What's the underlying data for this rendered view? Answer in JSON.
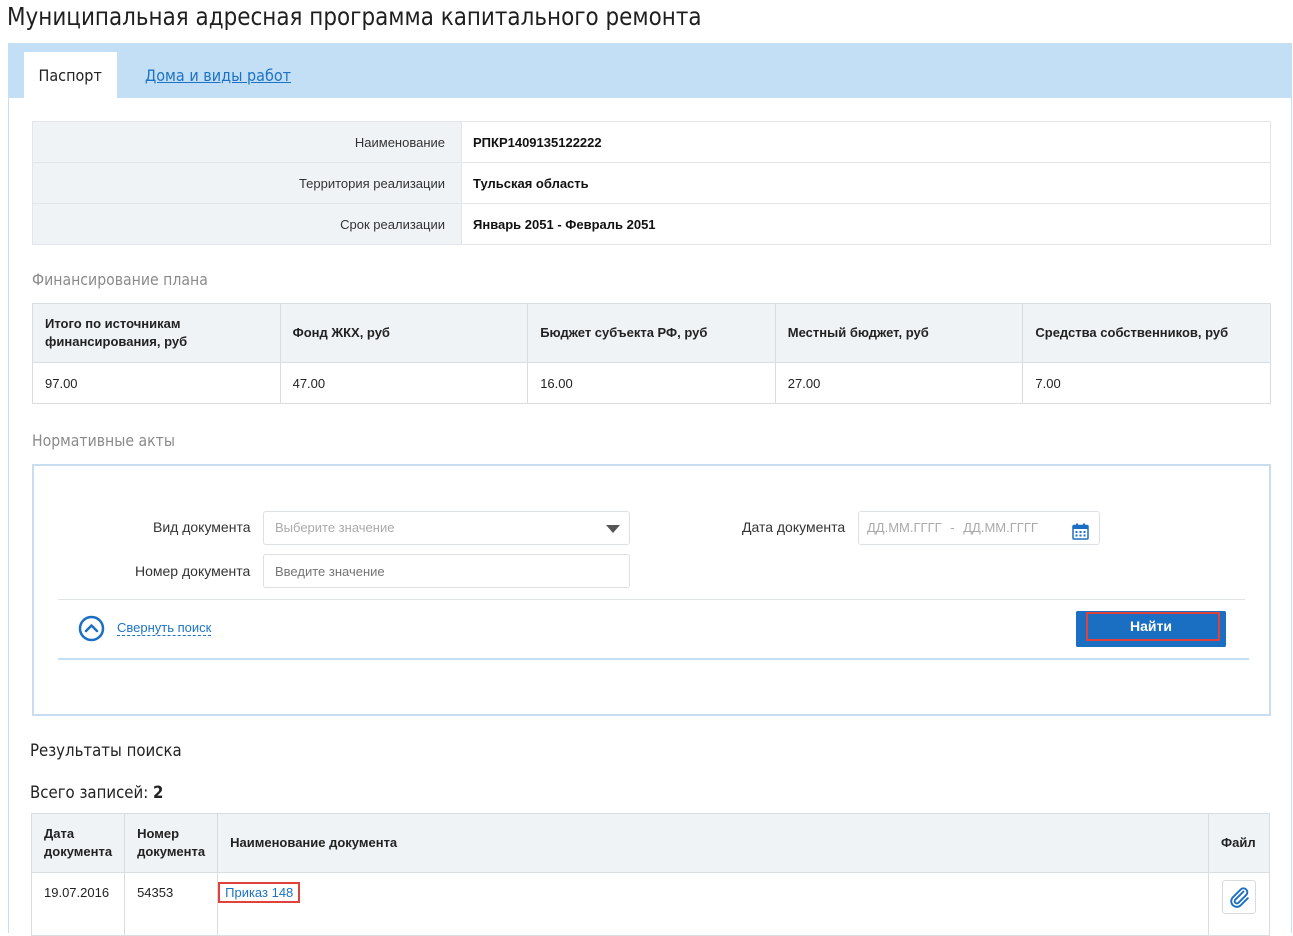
{
  "page": {
    "title": "Муниципальная адресная программа капитального ремонта"
  },
  "tabs": [
    {
      "label": "Паспорт",
      "active": true
    },
    {
      "label": "Дома и виды работ",
      "active": false
    }
  ],
  "info": {
    "rows": [
      {
        "label": "Наименование",
        "value": "РПКР1409135122222"
      },
      {
        "label": "Территория реализации",
        "value": "Тульская область"
      },
      {
        "label": "Срок реализации",
        "value": "Январь 2051  - Февраль 2051"
      }
    ]
  },
  "financing": {
    "title": "Финансирование плана",
    "headers": [
      "Итого по источникам финансирования, руб",
      "Фонд ЖКХ, руб",
      "Бюджет субъекта РФ, руб",
      "Местный бюджет, руб",
      "Средства собственников, руб"
    ],
    "values": [
      "97.00",
      "47.00",
      "16.00",
      "27.00",
      "7.00"
    ]
  },
  "acts": {
    "title": "Нормативные акты",
    "doc_type_label": "Вид документа",
    "doc_type_placeholder": "Выберите значение",
    "doc_number_label": "Номер документа",
    "doc_number_placeholder": "Введите значение",
    "doc_date_label": "Дата документа",
    "date_from_placeholder": "ДД.ММ.ГГГГ",
    "date_sep": "-",
    "date_to_placeholder": "ДД.ММ.ГГГГ",
    "collapse_label": "Свернуть поиск",
    "find_label": "Найти"
  },
  "results": {
    "title": "Результаты поиска",
    "total_label": "Всего записей:",
    "total_count": "2",
    "headers": [
      "Дата документа",
      "Номер документа",
      "Наименование документа",
      "Файл"
    ],
    "rows": [
      {
        "date": "19.07.2016",
        "number": "54353",
        "name": "Приказ 148"
      }
    ]
  },
  "colors": {
    "accent": "#1b6fc3",
    "tabbar": "#c3dff5",
    "highlight": "#e0413a",
    "link": "#1d73c2"
  },
  "icons": {
    "collapse": "chevron-up-circle-icon",
    "calendar": "calendar-icon",
    "file": "paperclip-icon",
    "select": "caret-down-icon"
  }
}
